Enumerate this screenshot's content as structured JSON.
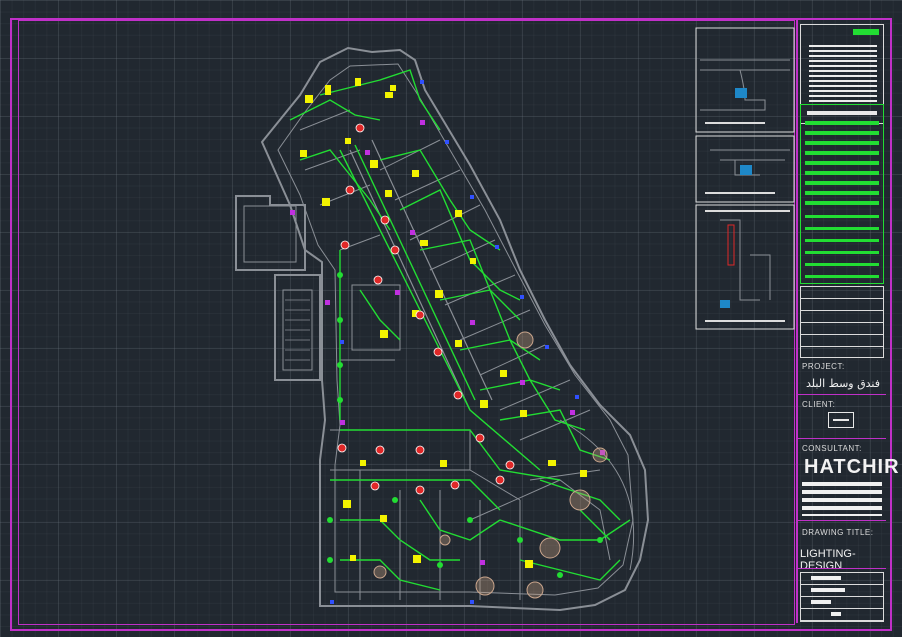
{
  "drawing": {
    "title_block": {
      "project_label": "PROJECT:",
      "project_name": "فندق وسط البلد",
      "client_label": "CLIENT:",
      "consultant_label": "CONSULTANT:",
      "company_name": "HATCHIR",
      "drawing_title_label": "DRAWING TITLE:",
      "drawing_title": "LIGHTING-DESIGN"
    },
    "colors": {
      "frame": "#c030c8",
      "background": "#212830",
      "walls": "#8a8f96",
      "circuits": "#22dd33",
      "fixtures_yellow": "#f3f300",
      "fixtures_red": "#e02828",
      "fixtures_magenta": "#c030e0",
      "fixtures_blue": "#3050ff"
    }
  }
}
